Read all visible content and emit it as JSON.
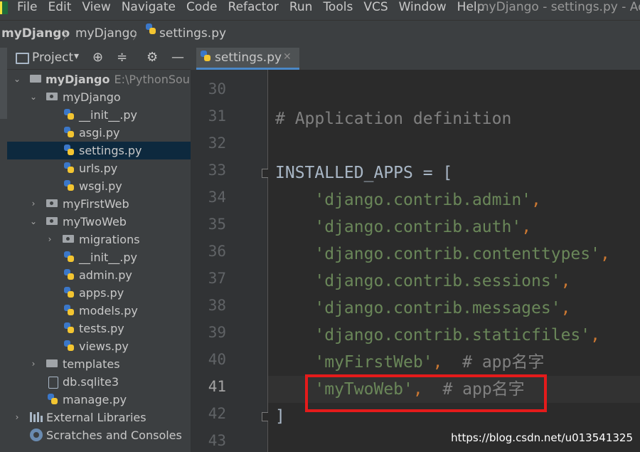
{
  "menubar": {
    "items": [
      "File",
      "Edit",
      "View",
      "Navigate",
      "Code",
      "Refactor",
      "Run",
      "Tools",
      "VCS",
      "Window",
      "Help"
    ],
    "window_title": "myDjango - settings.py - Adm"
  },
  "breadcrumb": [
    "myDjango",
    "myDjango",
    "settings.py"
  ],
  "project_panel": {
    "title": "Project",
    "tree": [
      {
        "label": "myDjango",
        "path": "E:\\PythonSour"
      },
      {
        "label": "myDjango"
      },
      {
        "label": "__init__.py"
      },
      {
        "label": "asgi.py"
      },
      {
        "label": "settings.py"
      },
      {
        "label": "urls.py"
      },
      {
        "label": "wsgi.py"
      },
      {
        "label": "myFirstWeb"
      },
      {
        "label": "myTwoWeb"
      },
      {
        "label": "migrations"
      },
      {
        "label": "__init__.py"
      },
      {
        "label": "admin.py"
      },
      {
        "label": "apps.py"
      },
      {
        "label": "models.py"
      },
      {
        "label": "tests.py"
      },
      {
        "label": "views.py"
      },
      {
        "label": "templates"
      },
      {
        "label": "db.sqlite3"
      },
      {
        "label": "manage.py"
      },
      {
        "label": "External Libraries"
      },
      {
        "label": "Scratches and Consoles"
      }
    ]
  },
  "editor": {
    "tab_label": "settings.py",
    "line_numbers": [
      "30",
      "31",
      "32",
      "33",
      "34",
      "35",
      "36",
      "37",
      "38",
      "39",
      "40",
      "41",
      "42",
      "43"
    ],
    "current_line": "41",
    "lines": {
      "l31": "# Application definition",
      "l33_name": "INSTALLED_APPS",
      "l33_rest": " = [",
      "l34": "'django.contrib.admin'",
      "l35": "'django.contrib.auth'",
      "l36": "'django.contrib.contenttypes'",
      "l37": "'django.contrib.sessions'",
      "l38": "'django.contrib.messages'",
      "l39": "'django.contrib.staticfiles'",
      "l40_str": "'myFirstWeb'",
      "l40_cm": "# app名字",
      "l41_str": "'myTwoWeb'",
      "l41_cm": "# app名字",
      "l42": "]"
    }
  },
  "watermark": "https://blog.csdn.net/u013541325",
  "colors": {
    "highlight_box": "#e41b1b",
    "string": "#6a8759",
    "comment": "#808080",
    "keyword_op": "#cc7832",
    "selection": "#0d293e"
  }
}
